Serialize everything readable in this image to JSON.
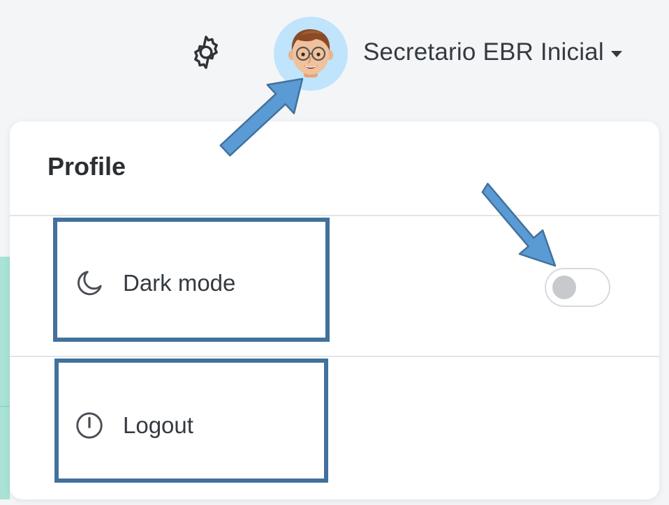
{
  "header": {
    "settings_icon": "gear-icon",
    "avatar_icon": "memoji-avatar",
    "user_name": "Secretario EBR Inicial"
  },
  "dropdown": {
    "title": "Profile",
    "items": [
      {
        "label": "Dark mode",
        "icon": "moon-icon",
        "toggle": {
          "on": false
        }
      },
      {
        "label": "Logout",
        "icon": "power-icon"
      }
    ]
  },
  "colors": {
    "avatar_bg": "#bfe4fb",
    "annotation_box": "#41719c",
    "annotation_arrow": "#5b9bd5",
    "teal_strip": "#a9e3d6"
  }
}
